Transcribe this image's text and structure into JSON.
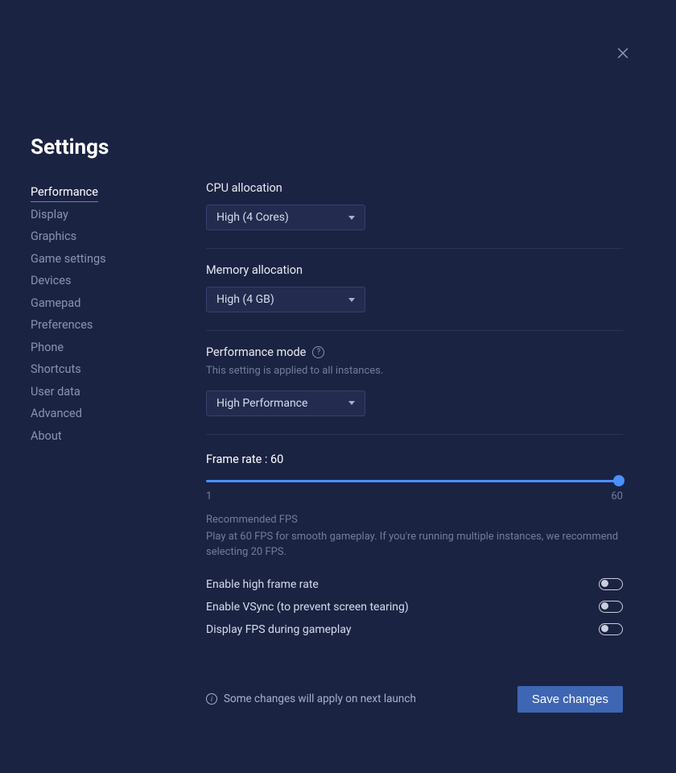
{
  "title": "Settings",
  "sidebar": {
    "items": [
      {
        "label": "Performance",
        "active": true
      },
      {
        "label": "Display"
      },
      {
        "label": "Graphics"
      },
      {
        "label": "Game settings"
      },
      {
        "label": "Devices"
      },
      {
        "label": "Gamepad"
      },
      {
        "label": "Preferences"
      },
      {
        "label": "Phone"
      },
      {
        "label": "Shortcuts"
      },
      {
        "label": "User data"
      },
      {
        "label": "Advanced"
      },
      {
        "label": "About"
      }
    ]
  },
  "cpu": {
    "label": "CPU allocation",
    "value": "High (4 Cores)"
  },
  "memory": {
    "label": "Memory allocation",
    "value": "High (4 GB)"
  },
  "perf_mode": {
    "label": "Performance mode",
    "hint": "This setting is applied to all instances.",
    "value": "High Performance"
  },
  "frame": {
    "label": "Frame rate : 60",
    "min": "1",
    "max": "60",
    "current": 60,
    "reco_title": "Recommended FPS",
    "reco_text": "Play at 60 FPS for smooth gameplay. If you're running multiple instances, we recommend selecting 20 FPS."
  },
  "toggles": {
    "high_frame": {
      "label": "Enable high frame rate",
      "on": false
    },
    "vsync": {
      "label": "Enable VSync (to prevent screen tearing)",
      "on": false
    },
    "display_fps": {
      "label": "Display FPS during gameplay",
      "on": false
    }
  },
  "footer": {
    "info": "Some changes will apply on next launch",
    "save": "Save changes"
  }
}
